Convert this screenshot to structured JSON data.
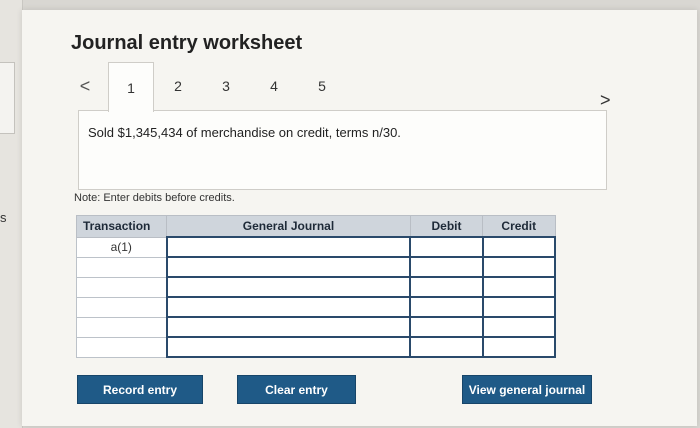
{
  "window_edge": {
    "fragment": "s"
  },
  "title": "Journal entry worksheet",
  "tabs": [
    {
      "label": "1",
      "active": true
    },
    {
      "label": "2",
      "active": false
    },
    {
      "label": "3",
      "active": false
    },
    {
      "label": "4",
      "active": false
    },
    {
      "label": "5",
      "active": false
    }
  ],
  "nav": {
    "prev_icon": "chevron-left-icon",
    "next_icon": "chevron-right-icon",
    "prev_glyph": "<",
    "next_glyph": ">"
  },
  "description": "Sold $1,345,434 of merchandise on credit, terms n/30.",
  "note": "Note: Enter debits before credits.",
  "table": {
    "headers": {
      "transaction": "Transaction",
      "general_journal": "General Journal",
      "debit": "Debit",
      "credit": "Credit"
    },
    "rows": [
      {
        "transaction": "a(1)",
        "account": "",
        "debit": "",
        "credit": ""
      },
      {
        "transaction": "",
        "account": "",
        "debit": "",
        "credit": ""
      },
      {
        "transaction": "",
        "account": "",
        "debit": "",
        "credit": ""
      },
      {
        "transaction": "",
        "account": "",
        "debit": "",
        "credit": ""
      },
      {
        "transaction": "",
        "account": "",
        "debit": "",
        "credit": ""
      },
      {
        "transaction": "",
        "account": "",
        "debit": "",
        "credit": ""
      }
    ]
  },
  "buttons": {
    "record": "Record entry",
    "clear": "Clear entry",
    "view": "View general journal"
  },
  "colors": {
    "button": "#1f5a87",
    "header": "#cfd5dc",
    "input_border": "#2a4a6b"
  }
}
